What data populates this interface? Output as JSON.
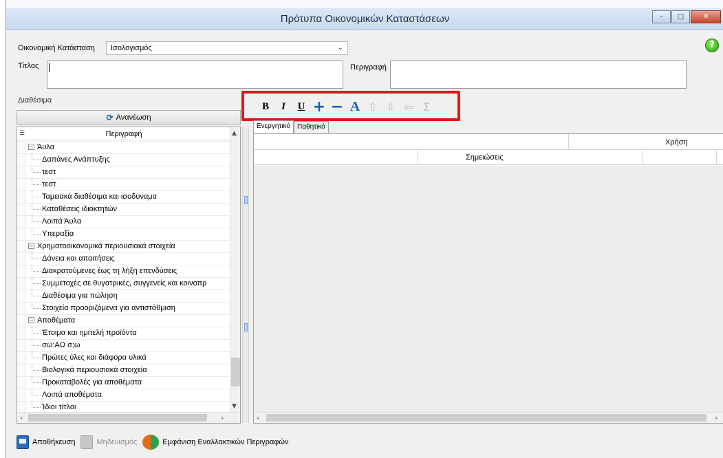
{
  "window": {
    "title": "Πρότυπα Οικονομικών Καταστάσεων",
    "minimize_glyph": "–",
    "maximize_glyph": "□",
    "close_glyph": "✕"
  },
  "form": {
    "statement_label": "Οικονομική Κατάσταση",
    "statement_value": "Ισολογισμός",
    "title_label": "Τίτλος",
    "title_value": "",
    "description_label": "Περιγραφή",
    "description_value": ""
  },
  "left_panel": {
    "section_label": "Διαθέσιμα",
    "refresh_label": "Ανανέωση",
    "column_header": "Περιγραφή",
    "tree": [
      {
        "label": "Άυλα",
        "level": 0,
        "expander": "–"
      },
      {
        "label": "Δαπάνες Ανάπτυξης",
        "level": 1
      },
      {
        "label": "τεστ",
        "level": 1
      },
      {
        "label": "τεστ",
        "level": 1
      },
      {
        "label": "Ταμειακά διαθέσιμα και ισοδύναμα",
        "level": 1
      },
      {
        "label": "Καταθέσεις ιδιοκτητών",
        "level": 1
      },
      {
        "label": "Λοιπά Άυλα",
        "level": 1
      },
      {
        "label": "Υπεραξία",
        "level": 1
      },
      {
        "label": "Χρηματοοικονομικά περιουσιακά στοιχεία",
        "level": 0,
        "expander": "–"
      },
      {
        "label": "Δάνεια και απαιτήσεις",
        "level": 1
      },
      {
        "label": "Διακρατούμενες έως τη λήξη επενδύσεις",
        "level": 1
      },
      {
        "label": "Συμμετοχές σε θυγατρικές, συγγενείς και κοινοπρ",
        "level": 1
      },
      {
        "label": "Διαθέσιμα για πώληση",
        "level": 1
      },
      {
        "label": "Στοιχεία προοριζόμενα για αντιστάθμιση",
        "level": 1
      },
      {
        "label": "Αποθέματα",
        "level": 0,
        "expander": "–"
      },
      {
        "label": "Έτοιμα και ημιτελή προϊόντα",
        "level": 1
      },
      {
        "label": "σω:ΑΩ σ;ω",
        "level": 1
      },
      {
        "label": "Πρώτες ύλες και διάφορα υλικά",
        "level": 1
      },
      {
        "label": "Βιολογικά περιουσιακά στοιχεία",
        "level": 1
      },
      {
        "label": "Προκαταβολές για αποθέματα",
        "level": 1
      },
      {
        "label": "Λοιπά αποθέματα",
        "level": 1
      },
      {
        "label": "Ίδιοι τίτλοι",
        "level": 1
      }
    ]
  },
  "toolbar": {
    "bold": "B",
    "italic": "I",
    "underline": "U",
    "add": "+",
    "remove": "−",
    "font": "A",
    "move_up": "⇧",
    "move_down": "⇩",
    "move_left": "⇦",
    "sum": "Σ"
  },
  "tabs": [
    "Ενεργητικό",
    "Παθητικό"
  ],
  "grid": {
    "header_year": "Χρήση",
    "header_notes": "Σημειώσεις"
  },
  "bottom": {
    "save_label": "Αποθήκευση",
    "reset_label": "Μηδενισμός",
    "alt_label": "Εμφάνιση Εναλλακτικών Περιγραφών"
  },
  "colors": {
    "highlight": "#e4141b",
    "accent": "#1b5fb5"
  }
}
